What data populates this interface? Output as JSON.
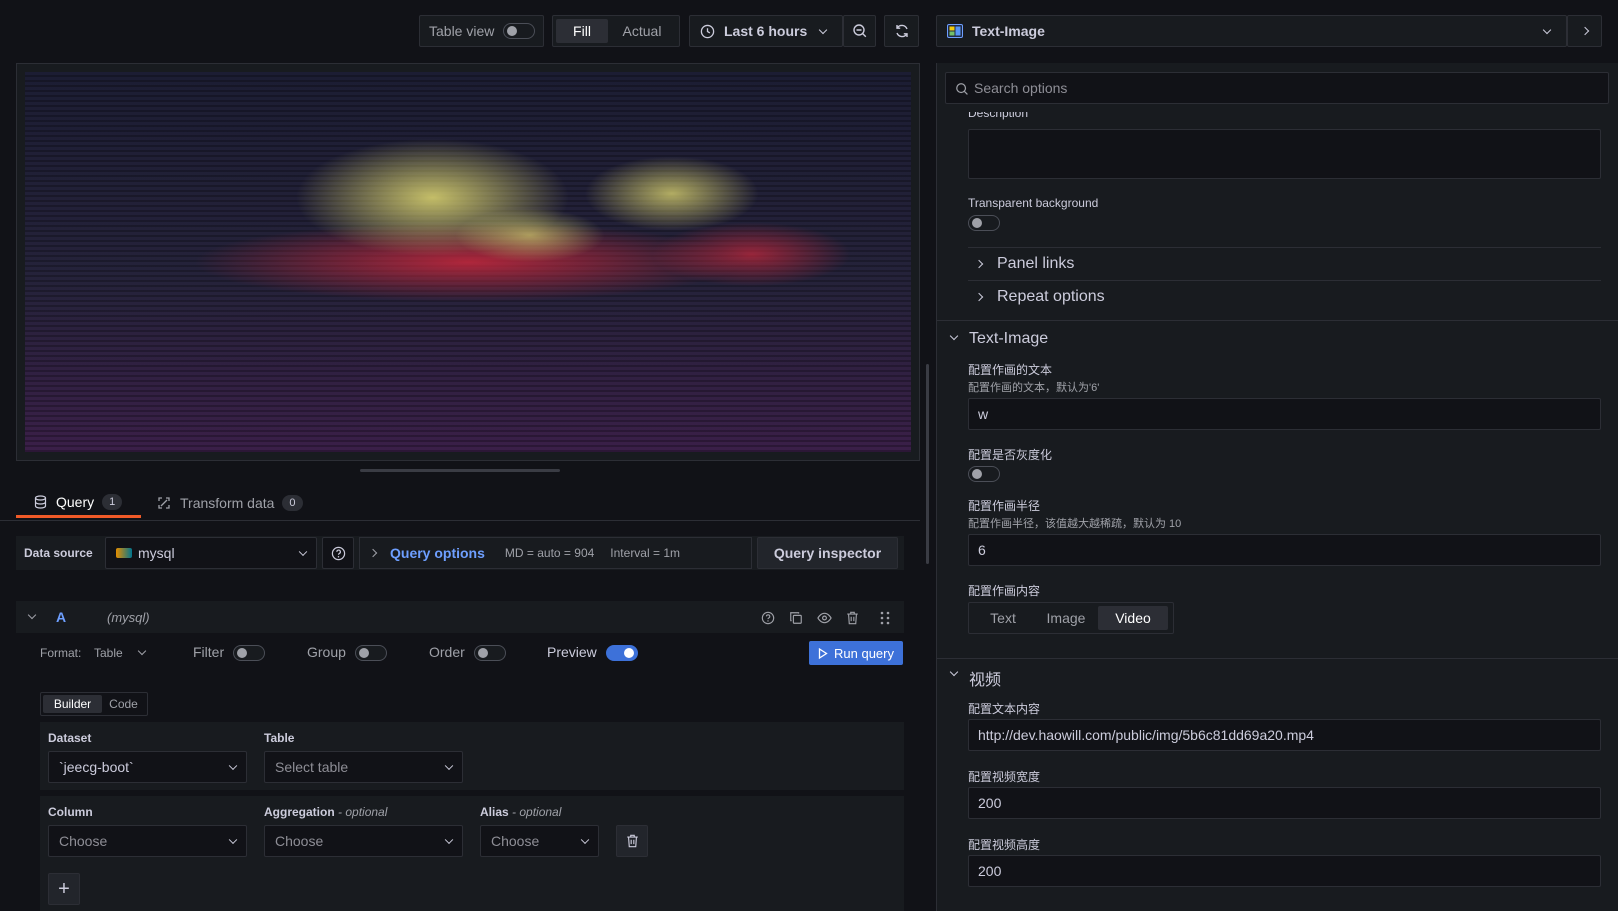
{
  "toolbar": {
    "table_view_label": "Table view",
    "fill_label": "Fill",
    "actual_label": "Actual",
    "time_range_label": "Last 6 hours"
  },
  "panel_header": {
    "title": "Text-Image"
  },
  "query_tabs": {
    "query_label": "Query",
    "query_count": "1",
    "transform_label": "Transform data",
    "transform_count": "0"
  },
  "datasource_row": {
    "label": "Data source",
    "value": "mysql",
    "query_options_label": "Query options",
    "md_text": "MD = auto = 904",
    "interval_text": "Interval = 1m",
    "inspector_label": "Query inspector"
  },
  "query_a": {
    "ref_id": "A",
    "datasource_hint": "(mysql)",
    "format_label": "Format:",
    "format_value": "Table",
    "filter_label": "Filter",
    "group_label": "Group",
    "order_label": "Order",
    "preview_label": "Preview",
    "run_label": "Run query",
    "builder_label": "Builder",
    "code_label": "Code",
    "dataset_label": "Dataset",
    "dataset_value": "`jeecg-boot`",
    "table_label": "Table",
    "table_placeholder": "Select table",
    "column_label": "Column",
    "column_placeholder": "Choose",
    "aggregation_label": "Aggregation",
    "optional_suffix": "- optional",
    "aggregation_placeholder": "Choose",
    "alias_label": "Alias",
    "alias_placeholder": "Choose"
  },
  "options": {
    "search_placeholder": "Search options",
    "description_label": "Description",
    "transparent_label": "Transparent background",
    "panel_links_label": "Panel links",
    "repeat_options_label": "Repeat options",
    "text_image_section": "Text-Image",
    "text_label": "配置作画的文本",
    "text_desc": "配置作画的文本，默认为'6'",
    "text_value": "w",
    "gray_label": "配置是否灰度化",
    "radius_label": "配置作画半径",
    "radius_desc": "配置作画半径，该值越大越稀疏，默认为 10",
    "radius_value": "6",
    "content_label": "配置作画内容",
    "content_options": [
      "Text",
      "Image",
      "Video"
    ],
    "content_selected": "Video",
    "video_section": "视频",
    "video_url_label": "配置文本内容",
    "video_url_value": "http://dev.haowill.com/public/img/5b6c81dd69a20.mp4",
    "video_width_label": "配置视频宽度",
    "video_width_value": "200",
    "video_height_label": "配置视频高度",
    "video_height_value": "200"
  },
  "colors": {
    "background": "#111217",
    "panel": "#181b1f",
    "border": "#2c2e35",
    "accent": "#3d71d9",
    "link": "#6e9fff",
    "tab_underline": "#f05a28"
  }
}
